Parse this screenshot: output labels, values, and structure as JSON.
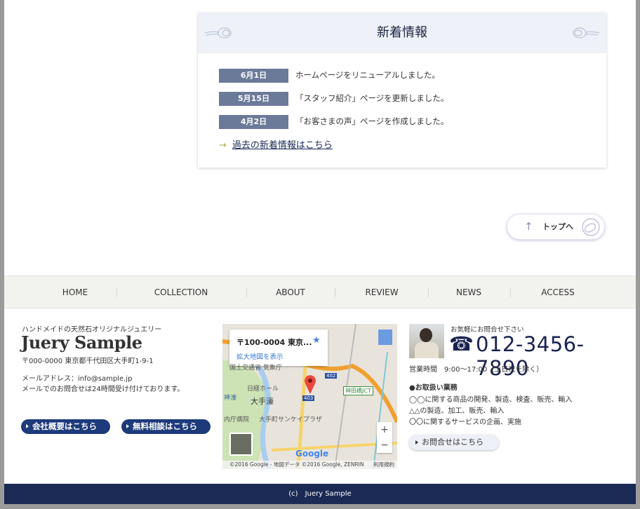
{
  "news": {
    "title": "新着情報",
    "items": [
      {
        "date": "6月1日",
        "text": "ホームページをリニューアルしました。"
      },
      {
        "date": "5月15日",
        "text": "「スタッフ紹介」ページを更新しました。"
      },
      {
        "date": "4月2日",
        "text": "「お客さまの声」ページを作成しました。"
      }
    ],
    "more_link": "過去の新着情報はこちら"
  },
  "to_top": "トップへ",
  "nav": [
    "HOME",
    "COLLECTION",
    "ABOUT",
    "REVIEW",
    "NEWS",
    "ACCESS"
  ],
  "company": {
    "tagline": "ハンドメイドの天然石オリジナルジュエリー",
    "name": "Juery Sample",
    "address": "〒000-0000 東京都千代田区大手町1-9-1",
    "email": "メールアドレス：info@sample.jp",
    "email_note": "メールでのお問合せは24時間受け付けております。",
    "btn_about": "会社概要はこちら",
    "btn_consult": "無料相談はこちら"
  },
  "map": {
    "address": "〒100-0004 東京...",
    "enlarge": "拡大地図を表示",
    "labels": [
      "国土交通省 気象庁",
      "日経ホール",
      "神濠",
      "大手濠",
      "内庁病院",
      "大手町サンケイプラザ",
      "神田橋JCT",
      "402",
      "403"
    ],
    "logo": "Google",
    "attribution": "©2016 Google - 地図データ ©2016 Google, ZENRIN",
    "terms": "利用規約",
    "zoom_in": "+",
    "zoom_out": "−"
  },
  "contact": {
    "lead": "お気軽にお問合せ下さい",
    "phone": "012-3456-7890",
    "hours": "営業時間　9:00〜17:00（土日祝を除く）",
    "services_title": "●お取扱い業務",
    "services": [
      "◯◯に関する商品の開発、製造、検査、販売、輸入",
      "△△の製造、加工、販売、輸入",
      "〇〇に関するサービスの企画、実施"
    ],
    "button": "お問合せはこちら"
  },
  "footer": {
    "copyright": "(c)　Juery Sample"
  },
  "colors": {
    "navy": "#1b2a55",
    "date_badge": "#6b7a99",
    "button": "#1d3a7a"
  }
}
